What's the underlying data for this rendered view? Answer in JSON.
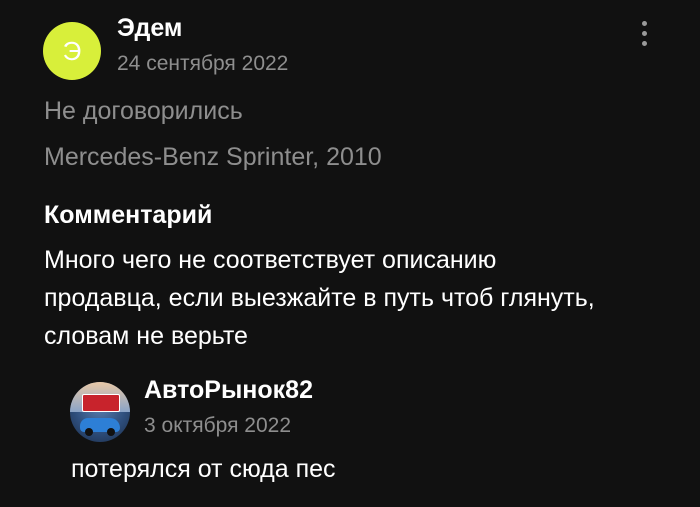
{
  "review": {
    "author_initial": "Э",
    "author_name": "Эдем",
    "date": "24 сентября 2022",
    "status": "Не договорились",
    "vehicle": "Mercedes-Benz Sprinter, 2010",
    "comment_label": "Комментарий",
    "comment_text": "Много чего не соответствует описанию продавца, если выезжайте в путь чтоб глянуть, словам не верьте",
    "avatar_color": "#d8ef3a",
    "menu_icon": "more-vertical-icon"
  },
  "reply": {
    "author_name": "АвтоРынок82",
    "date": "3 октября 2022",
    "text": "потерялся от сюда пес",
    "avatar_logo_text": "Авто Рынок82"
  },
  "colors": {
    "background": "#111111",
    "primary_text": "#ffffff",
    "secondary_text": "#8e8e8e"
  }
}
